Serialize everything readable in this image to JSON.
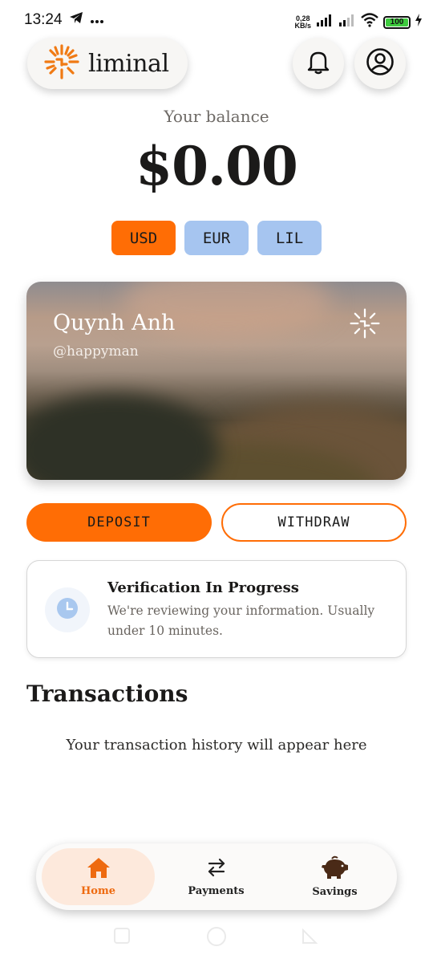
{
  "status_bar": {
    "time": "13:24",
    "net_speed_value": "0,28",
    "net_speed_unit": "KB/s",
    "battery": "100",
    "icons": [
      "telegram-icon",
      "more-dots-icon",
      "signal-icon",
      "signal-icon",
      "wifi-icon",
      "battery-icon",
      "charging-icon"
    ]
  },
  "header": {
    "brand": "liminal",
    "brand_color": "#f07a14",
    "buttons": [
      "bell-icon",
      "profile-icon"
    ]
  },
  "balance": {
    "label": "Your balance",
    "amount": "$0.00"
  },
  "currencies": [
    {
      "label": "USD",
      "active": true
    },
    {
      "label": "EUR",
      "active": false
    },
    {
      "label": "LIL",
      "active": false
    }
  ],
  "card": {
    "name": "Quynh Anh",
    "handle": "@happyman"
  },
  "actions": {
    "deposit": "DEPOSIT",
    "withdraw": "WITHDRAW",
    "accent": "#ff6d05"
  },
  "verification": {
    "title": "Verification In Progress",
    "text": "We're reviewing your information. Usually under 10 minutes.",
    "icon": "clock-icon"
  },
  "transactions": {
    "title": "Transactions",
    "empty": "Your transaction history will appear here"
  },
  "bottom_nav": {
    "items": [
      {
        "label": "Home",
        "icon": "home-icon",
        "active": true
      },
      {
        "label": "Payments",
        "icon": "transfer-arrows-icon",
        "active": false
      },
      {
        "label": "Savings",
        "icon": "piggy-bank-icon",
        "active": false
      }
    ]
  }
}
